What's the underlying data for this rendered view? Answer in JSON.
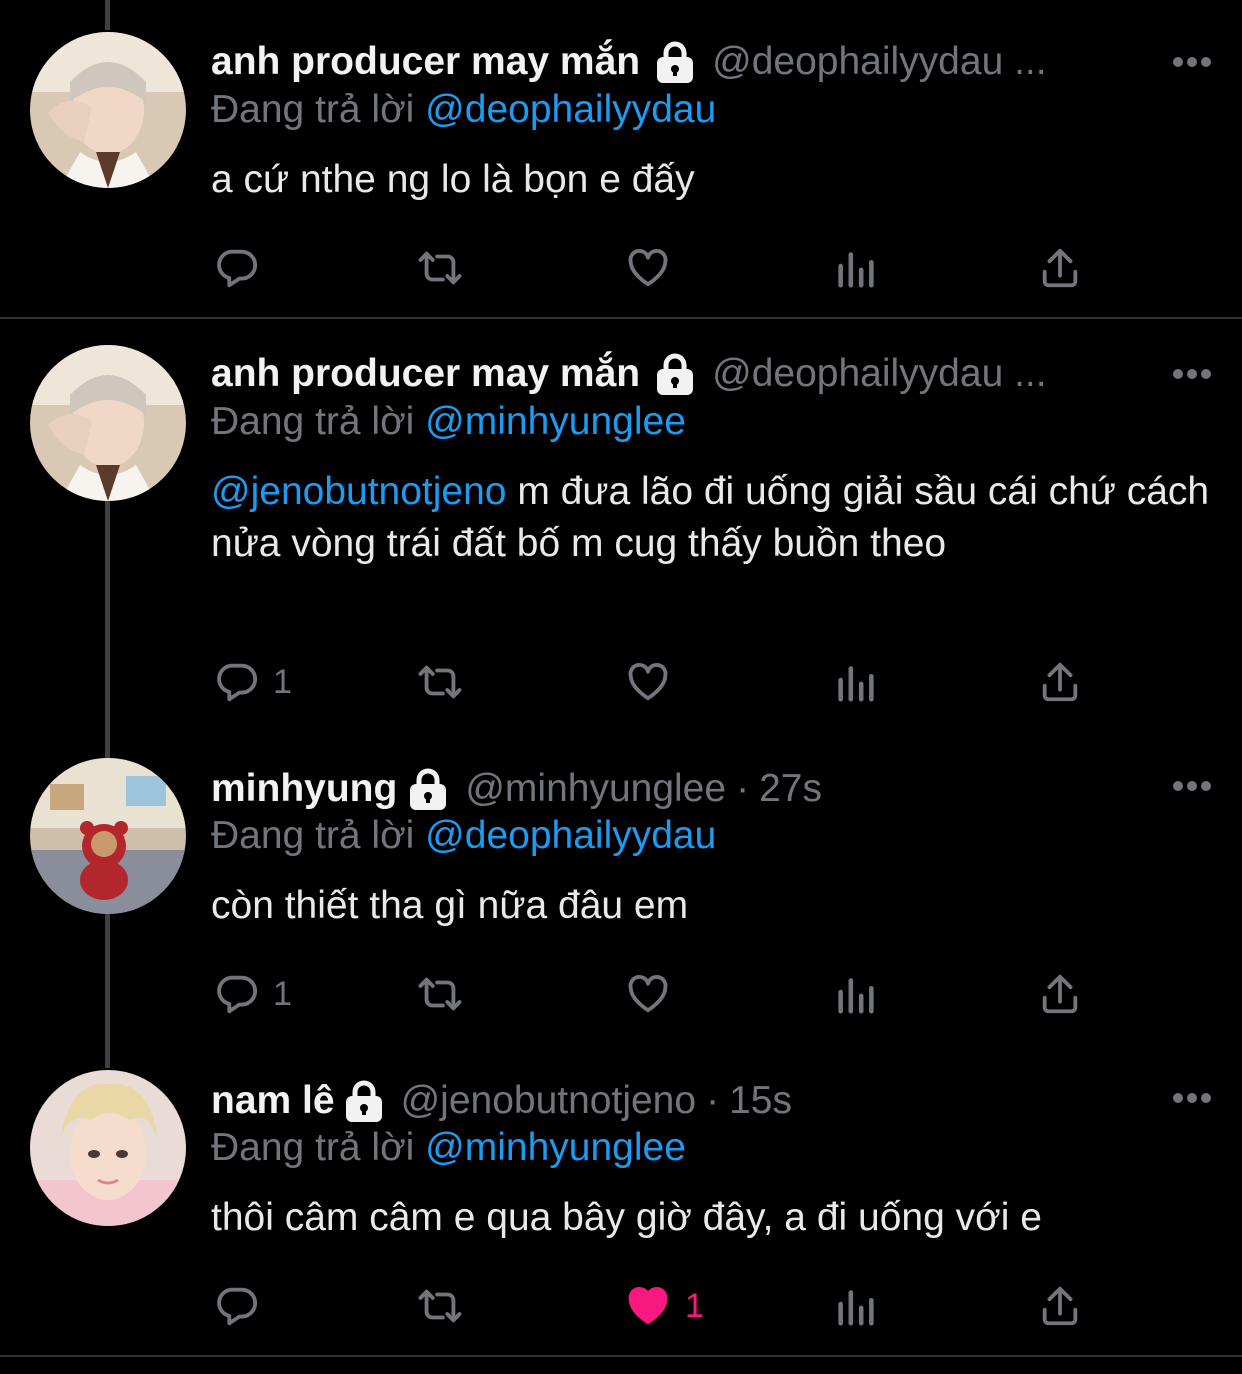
{
  "ui": {
    "reply_prefix": "Đang trả lời",
    "colors": {
      "background": "#000000",
      "text": "#e7e9ea",
      "muted": "#71767b",
      "link": "#1d9bf0",
      "like": "#f91880",
      "thread_line": "#3e4144"
    }
  },
  "tweets": [
    {
      "name": "anh producer may mắn",
      "handle": "@deophailyydau ...",
      "protected": true,
      "replying_to": "@deophailyydau",
      "text": "a cứ nthe ng lo là bọn e đấy",
      "mention": "",
      "replies": "",
      "likes": "",
      "liked": false
    },
    {
      "name": "anh producer may mắn",
      "handle": "@deophailyydau ...",
      "protected": true,
      "replying_to": "@minhyunglee",
      "mention": "@jenobutnotjeno",
      "text": " m đưa lão đi uống giải sầu cái chứ cách nửa vòng trái đất bố m cug thấy buồn theo",
      "replies": "1",
      "likes": "",
      "liked": false
    },
    {
      "name": "minhyung",
      "handle": "@minhyunglee",
      "time": "27s",
      "protected": true,
      "replying_to": "@deophailyydau",
      "mention": "",
      "text": "còn thiết tha gì nữa đâu em",
      "replies": "1",
      "likes": "",
      "liked": false
    },
    {
      "name": "nam lê",
      "handle": "@jenobutnotjeno",
      "time": "15s",
      "protected": true,
      "replying_to": "@minhyunglee",
      "mention": "",
      "text": "thôi câm câm e qua bây giờ đây, a đi uống với e",
      "replies": "",
      "likes": "1",
      "liked": true
    }
  ],
  "icons": {
    "reply": "reply-icon",
    "retweet": "retweet-icon",
    "like": "heart-icon",
    "views": "analytics-icon",
    "share": "share-icon",
    "more": "more-icon",
    "protected": "lock-icon"
  }
}
